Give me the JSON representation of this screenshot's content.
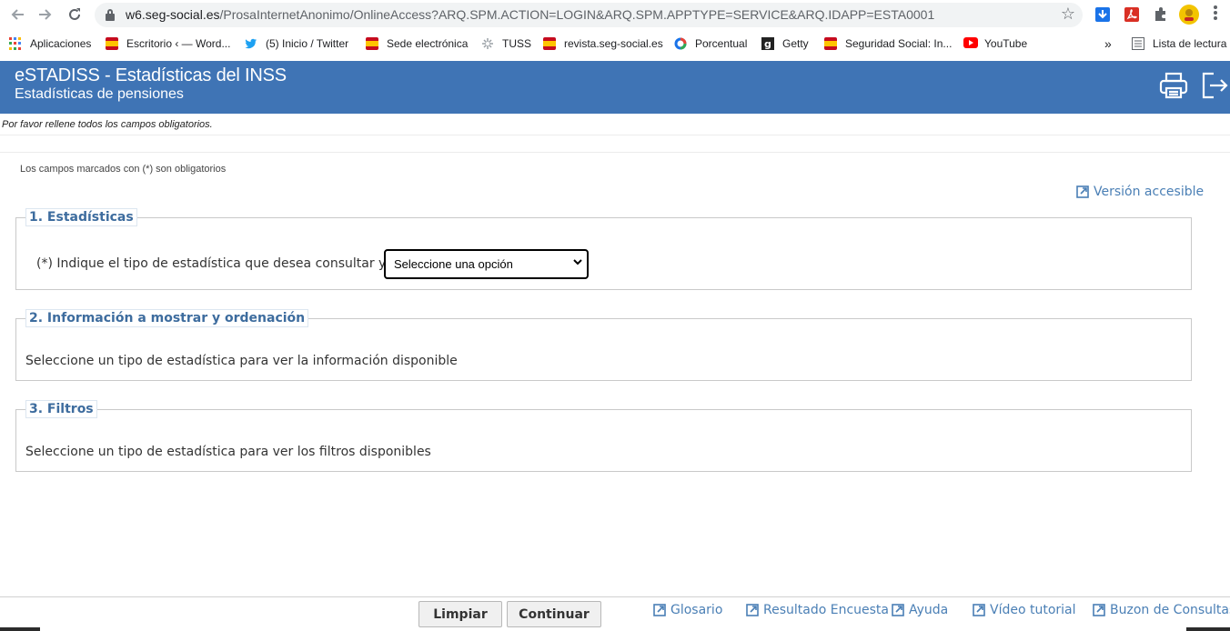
{
  "browser": {
    "url_host": "w6.seg-social.es",
    "url_path": "/ProsaInternetAnonimo/OnlineAccess?ARQ.SPM.ACTION=LOGIN&ARQ.SPM.APPTYPE=SERVICE&ARQ.IDAPP=ESTA0001",
    "icons": [
      "back-arrow-icon",
      "forward-arrow-icon",
      "reload-icon",
      "lock-icon",
      "star-icon",
      "download-extension-icon",
      "pdf-extension-icon",
      "puzzle-extensions-icon",
      "profile-avatar",
      "kebab-menu-icon"
    ]
  },
  "bookmarks": {
    "items": [
      {
        "label": "Aplicaciones",
        "icon": "apps-grid-icon"
      },
      {
        "label": "Escritorio ‹ — Word...",
        "icon": "spain-shield-icon"
      },
      {
        "label": "(5) Inicio / Twitter",
        "icon": "twitter-icon"
      },
      {
        "label": "Sede electrónica",
        "icon": "spain-shield-icon"
      },
      {
        "label": "TUSS",
        "icon": "tuss-icon"
      },
      {
        "label": "revista.seg-social.es",
        "icon": "spain-shield-icon"
      },
      {
        "label": "Porcentual",
        "icon": "ring-icon"
      },
      {
        "label": "Getty",
        "icon": "getty-icon"
      },
      {
        "label": "Seguridad Social: In...",
        "icon": "spain-shield-icon"
      },
      {
        "label": "YouTube",
        "icon": "youtube-icon"
      }
    ],
    "overflow": "»",
    "reading_list": "Lista de lectura"
  },
  "header": {
    "title": "eSTADISS - Estadísticas del INSS",
    "subtitle": "Estadísticas de pensiones",
    "bg_color": "#3f74b5",
    "icons": [
      "printer-icon",
      "logout-icon"
    ]
  },
  "notice": "Por favor rellene todos los campos obligatorios.",
  "required_note": "Los campos marcados con (*) son obligatorios",
  "accessible_link": "Versión accesible",
  "sections": [
    {
      "legend": "1. Estadísticas",
      "prompt": "(*) Indique el tipo de estadística que desea consultar y pulse",
      "select_value": "Seleccione una opción"
    },
    {
      "legend": "2. Información a mostrar y ordenación",
      "text": "Seleccione un tipo de estadística para ver la información disponible"
    },
    {
      "legend": "3. Filtros",
      "text": "Seleccione un tipo de estadística para ver los filtros disponibles"
    }
  ],
  "footer": {
    "buttons": {
      "clear": "Limpiar",
      "continue": "Continuar"
    },
    "links": [
      "Glosario",
      "Resultado Encuesta",
      "Ayuda",
      "Vídeo tutorial",
      "Buzon de Consultas"
    ]
  },
  "colors": {
    "link": "#4a7fb5",
    "legend": "#3d6c9e"
  }
}
